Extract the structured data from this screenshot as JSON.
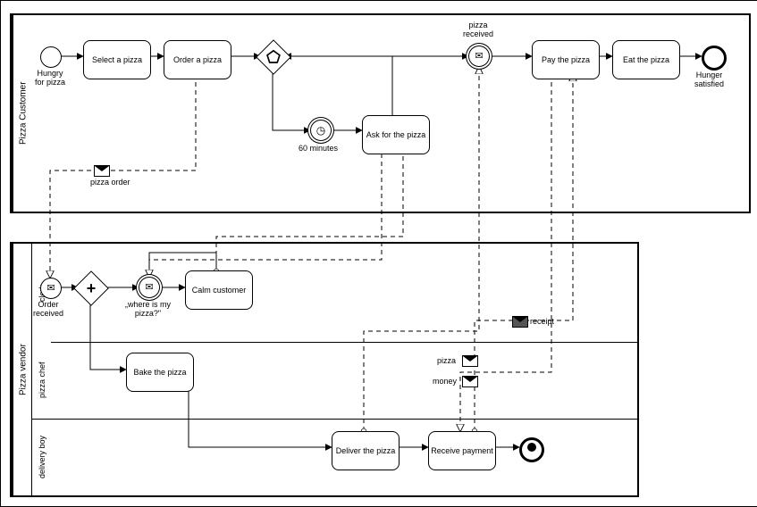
{
  "diagramType": "BPMN collaboration",
  "pools": {
    "customer": {
      "name": "Pizza Customer"
    },
    "vendor": {
      "name": "Pizza vendor",
      "lanes": {
        "clerk": "clerk",
        "chef": "pizza chef",
        "delivery": "delivery boy"
      }
    }
  },
  "events": {
    "hungry": {
      "label": "Hungry\nfor pizza",
      "type": "start"
    },
    "satisfied": {
      "label": "Hunger\nsatisfied",
      "type": "end"
    },
    "pizzaReceived": {
      "label": "pizza\nreceived",
      "type": "message intermediate catch"
    },
    "timer60": {
      "label": "60 minutes",
      "type": "timer intermediate catch"
    },
    "orderReceived": {
      "label": "Order\nreceived",
      "type": "message start"
    },
    "whereIsPizza": {
      "label": "„where is my\npizza?\"",
      "type": "message intermediate catch"
    },
    "vendorEnd": {
      "label": "",
      "type": "terminate end"
    }
  },
  "tasks": {
    "selectPizza": "Select a pizza",
    "orderPizza": "Order a pizza",
    "askPizza": "Ask for the\npizza",
    "payPizza": "Pay the pizza",
    "eatPizza": "Eat the pizza",
    "calmCustomer": "Calm\ncustomer",
    "bakePizza": "Bake the pizza",
    "deliverPizza": "Deliver the\npizza",
    "receivePayment": "Receive\npayment"
  },
  "gateways": {
    "eventBased": {
      "type": "event-based exclusive"
    },
    "parallel": {
      "type": "parallel"
    }
  },
  "messageFlows": {
    "pizzaOrder": "pizza order",
    "pizza": "pizza",
    "money": "money",
    "receipt": "receipt"
  }
}
